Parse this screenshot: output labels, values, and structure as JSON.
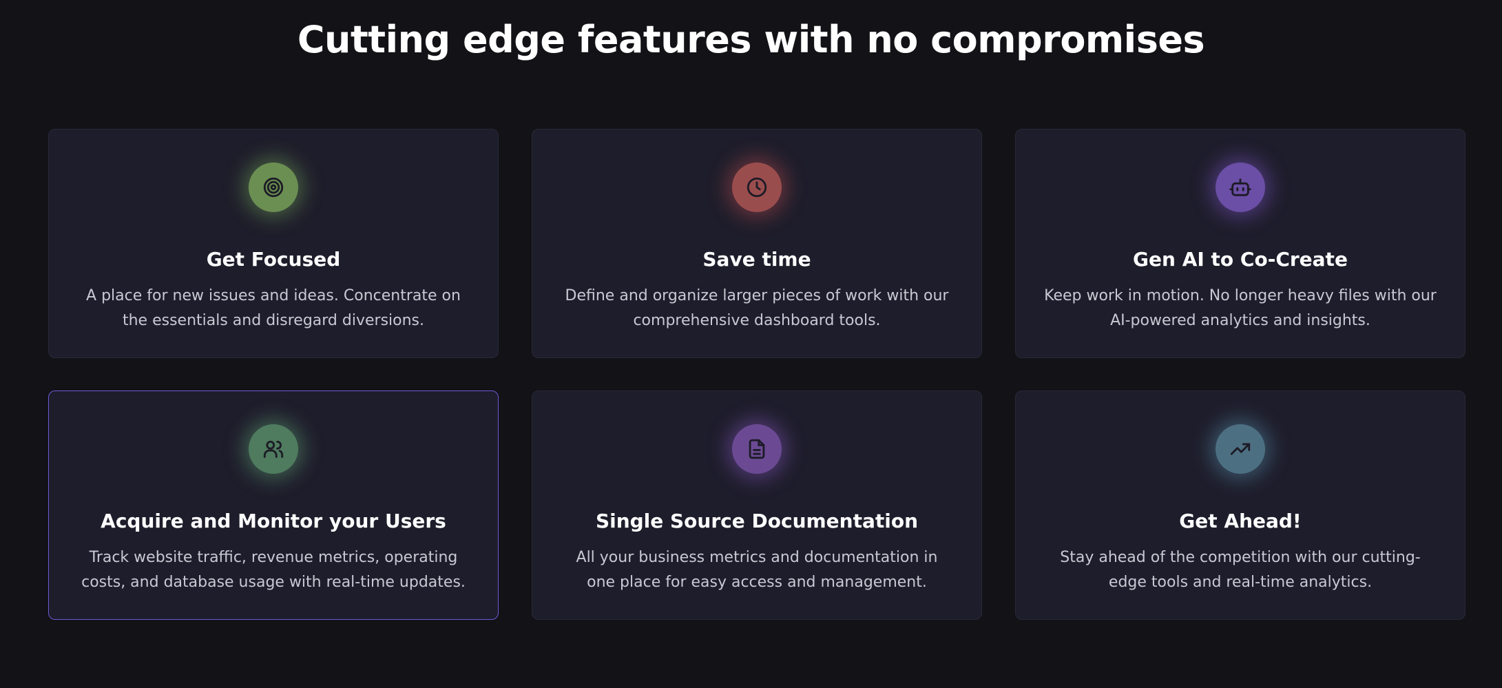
{
  "heading": "Cutting edge features with no compromises",
  "colors": {
    "background": "#121217",
    "card": "#1e1d2b",
    "active_border": "#6c5ad6"
  },
  "cards": [
    {
      "title": "Get Focused",
      "description": "A place for new issues and ideas. Concentrate on the essentials and disregard diversions.",
      "icon": "target-icon",
      "icon_color": "#6b8f52",
      "glow_color": "rgba(120,170,90,0.45)"
    },
    {
      "title": "Save time",
      "description": "Define and organize larger pieces of work with our comprehensive dashboard tools.",
      "icon": "clock-icon",
      "icon_color": "#9a4d4d",
      "glow_color": "rgba(190,80,80,0.45)"
    },
    {
      "title": "Gen AI to Co-Create",
      "description": "Keep work in motion. No longer heavy files with our AI-powered analytics and insights.",
      "icon": "bot-icon",
      "icon_color": "#6b4ea6",
      "glow_color": "rgba(130,90,210,0.45)"
    },
    {
      "title": "Acquire and Monitor your Users",
      "description": "Track website traffic, revenue metrics, operating costs, and database usage with real-time updates.",
      "icon": "users-icon",
      "icon_color": "#4f7b5f",
      "glow_color": "rgba(100,170,120,0.45)",
      "active": true
    },
    {
      "title": "Single Source Documentation",
      "description": "All your business metrics and documentation in one place for easy access and management.",
      "icon": "document-icon",
      "icon_color": "#6b4a93",
      "glow_color": "rgba(140,90,200,0.45)"
    },
    {
      "title": "Get Ahead!",
      "description": "Stay ahead of the competition with our cutting-edge tools and real-time analytics.",
      "icon": "trending-up-icon",
      "icon_color": "#4d6f82",
      "glow_color": "rgba(90,150,180,0.45)"
    }
  ]
}
